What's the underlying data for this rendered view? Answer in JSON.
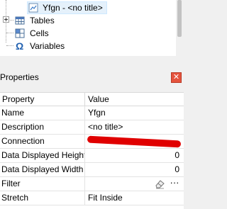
{
  "tree": {
    "items": [
      {
        "label": "Yfgn - <no title>",
        "icon": "report-page-icon",
        "selected": true
      },
      {
        "label": "Tables",
        "icon": "table-icon",
        "expandable": true
      },
      {
        "label": "Cells",
        "icon": "cells-icon"
      },
      {
        "label": "Variables",
        "icon": "omega-icon"
      }
    ]
  },
  "properties": {
    "title": "Properties",
    "close_icon": "close-icon",
    "columns": {
      "property": "Property",
      "value": "Value"
    },
    "rows": [
      {
        "name": "Name",
        "value": "Yfgn"
      },
      {
        "name": "Description",
        "value": "<no title>"
      },
      {
        "name": "Connection",
        "value": ""
      },
      {
        "name": "Data Displayed Height",
        "value": "0"
      },
      {
        "name": "Data Displayed Width (",
        "value": "0"
      },
      {
        "name": "Filter",
        "value": ""
      },
      {
        "name": "Stretch",
        "value": "Fit Inside"
      }
    ],
    "filter_more_label": "···",
    "colors": {
      "redaction": "#e00000",
      "close": "#e5533d",
      "selection": "#e5f1fb"
    }
  }
}
